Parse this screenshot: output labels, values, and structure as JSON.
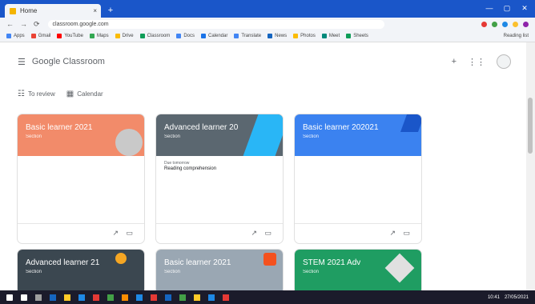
{
  "browser": {
    "tab_title": "Home",
    "tab_close": "×",
    "new_tab": "+",
    "window_controls": [
      "—",
      "▢",
      "✕"
    ],
    "nav_buttons": [
      "←",
      "→",
      "⟳"
    ],
    "url": "classroom.google.com",
    "extension_colors": [
      "#e53935",
      "#43a047",
      "#1e88e5",
      "#fbc02d",
      "#8e24aa"
    ],
    "bookmarks": [
      {
        "label": "Apps",
        "color": "#4285f4"
      },
      {
        "label": "Gmail",
        "color": "#ea4335"
      },
      {
        "label": "YouTube",
        "color": "#ff0000"
      },
      {
        "label": "Maps",
        "color": "#34a853"
      },
      {
        "label": "Drive",
        "color": "#fbbc05"
      },
      {
        "label": "Classroom",
        "color": "#0f9d58"
      },
      {
        "label": "Docs",
        "color": "#4285f4"
      },
      {
        "label": "Calendar",
        "color": "#1a73e8"
      },
      {
        "label": "Translate",
        "color": "#4285f4"
      },
      {
        "label": "News",
        "color": "#1565c0"
      },
      {
        "label": "Photos",
        "color": "#fbbc05"
      },
      {
        "label": "Meet",
        "color": "#00897b"
      },
      {
        "label": "Sheets",
        "color": "#0f9d58"
      }
    ],
    "reading_list": "Reading list"
  },
  "app": {
    "menu_icon": "☰",
    "title": "Google Classroom",
    "add_icon": "+",
    "apps_icon": "⋮⋮"
  },
  "subnav": [
    {
      "icon": "☷",
      "label": "To review"
    },
    {
      "icon": "▦",
      "label": "Calendar"
    }
  ],
  "cards": [
    {
      "name": "Basic learner 2021",
      "section": "Section",
      "color": "#f28b6a",
      "deco": "#c9c9c9",
      "due_label": "",
      "due_text": ""
    },
    {
      "name": "Advanced learner 20",
      "section": "Section",
      "color": "#5b6770",
      "deco": "#29b6f6",
      "due_label": "Due tomorrow",
      "due_text": "Reading comprehension"
    },
    {
      "name": "Basic learner 202021",
      "section": "Section",
      "color": "#3b82f0",
      "deco": "#1a56c9",
      "due_label": "",
      "due_text": ""
    },
    {
      "name": "Advanced learner 21",
      "section": "Section",
      "color": "#3b4750",
      "deco": "#f5a623",
      "due_label": "",
      "due_text": ""
    },
    {
      "name": "Basic learner 2021",
      "section": "Section",
      "color": "#9aa7b3",
      "deco": "#f4511e",
      "due_label": "",
      "due_text": ""
    },
    {
      "name": "STEM 2021 Adv",
      "section": "Section",
      "color": "#1f9d62",
      "deco": "#e0e0e0",
      "due_label": "",
      "due_text": ""
    }
  ],
  "card_icons": {
    "trend": "↗",
    "folder": "▭"
  },
  "taskbar": {
    "icon_colors": [
      "#ffffff",
      "#ffffff",
      "#9e9e9e",
      "#1565c0",
      "#ffca28",
      "#1e88e5",
      "#e53935",
      "#43a047",
      "#fb8c00",
      "#1e88e5",
      "#e53935",
      "#1565c0",
      "#43a047",
      "#ffca28",
      "#1e88e5",
      "#e53935"
    ],
    "time": "10:41",
    "date": "27/05/2021"
  }
}
